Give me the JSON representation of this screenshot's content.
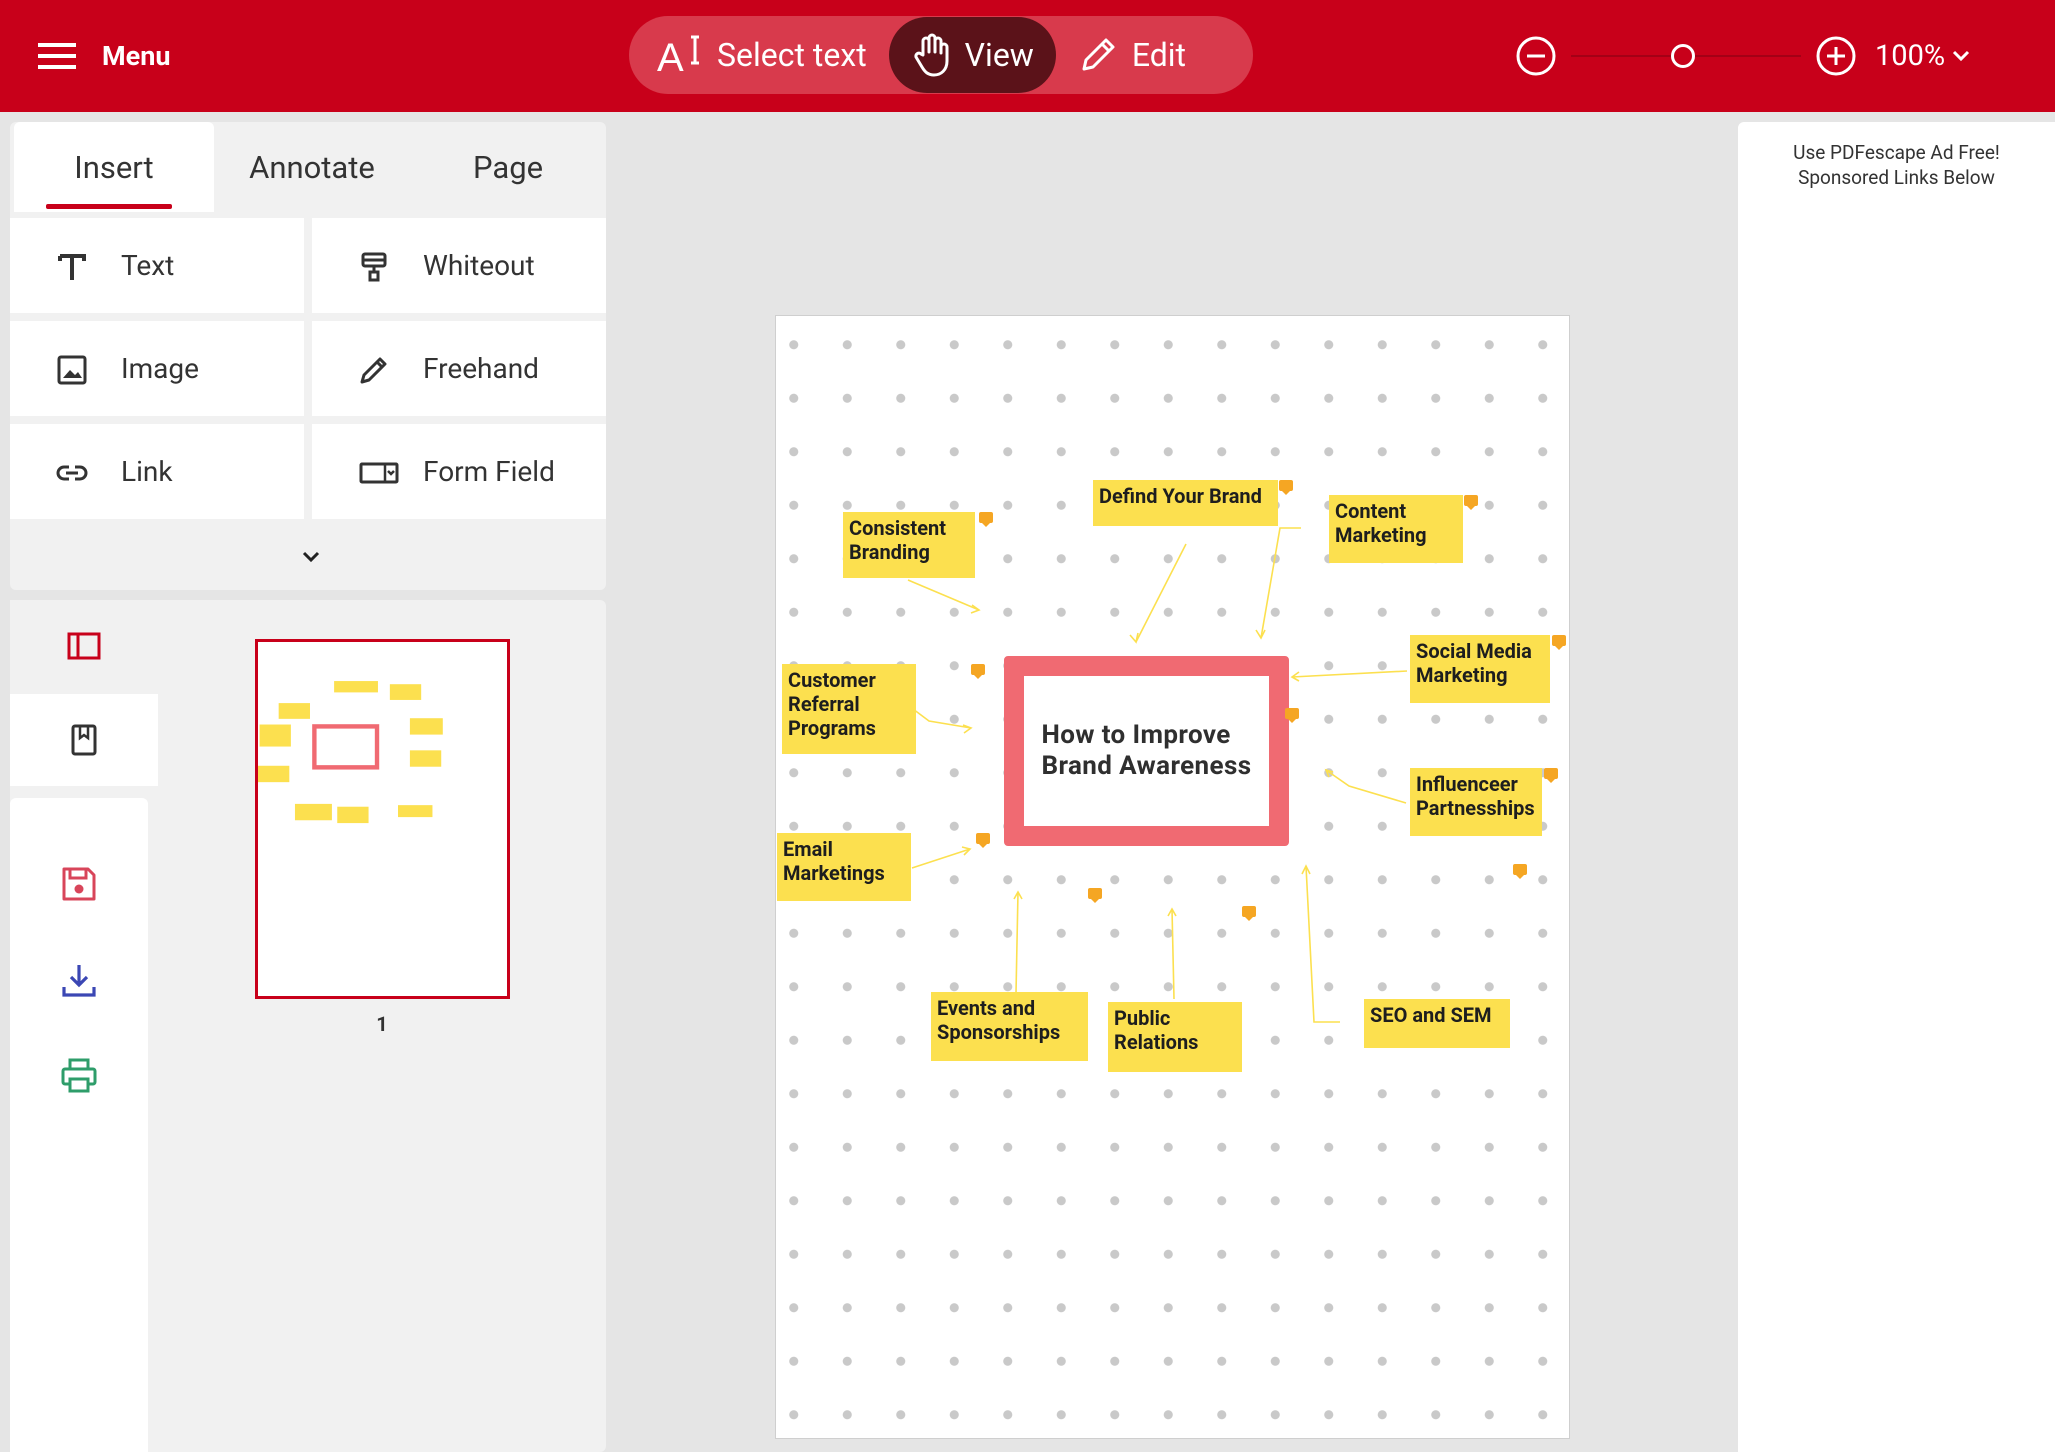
{
  "topbar": {
    "menu_label": "Menu",
    "modes": {
      "select_text": "Select text",
      "view": "View",
      "edit": "Edit"
    },
    "zoom_level": "100%"
  },
  "tool_tabs": {
    "insert": "Insert",
    "annotate": "Annotate",
    "page": "Page"
  },
  "tools": {
    "text": "Text",
    "whiteout": "Whiteout",
    "image": "Image",
    "freehand": "Freehand",
    "link": "Link",
    "form_field": "Form Field"
  },
  "thumbnail": {
    "page_number": "1"
  },
  "ad": {
    "line1": "Use PDFescape Ad Free!",
    "line2": "Sponsored Links Below"
  },
  "document": {
    "center_title": "How to Improve Brand Awareness",
    "center_line1": "How to Improve",
    "center_line2": "Brand Awareness",
    "notes": {
      "consistent_branding": [
        "Consistent",
        "Branding"
      ],
      "defind_your_brand": [
        "Defind Your Brand"
      ],
      "content_marketing": [
        "Content",
        "Marketing"
      ],
      "customer_referral": [
        "Customer",
        "Referral",
        "Programs"
      ],
      "social_media": [
        "Social Media",
        "Marketing"
      ],
      "influencer": [
        "Influenceer",
        "Partnesships"
      ],
      "email": [
        "Email",
        "Marketings"
      ],
      "events": [
        "Events and",
        "Sponsorships"
      ],
      "public_relations": [
        "Public",
        "Relations"
      ],
      "seo": [
        "SEO and SEM"
      ]
    }
  },
  "colors": {
    "brand_red": "#c8001a",
    "note_yellow": "#fce04f",
    "mindmap_frame": "#f06a72",
    "comment_orange": "#f5a623"
  }
}
